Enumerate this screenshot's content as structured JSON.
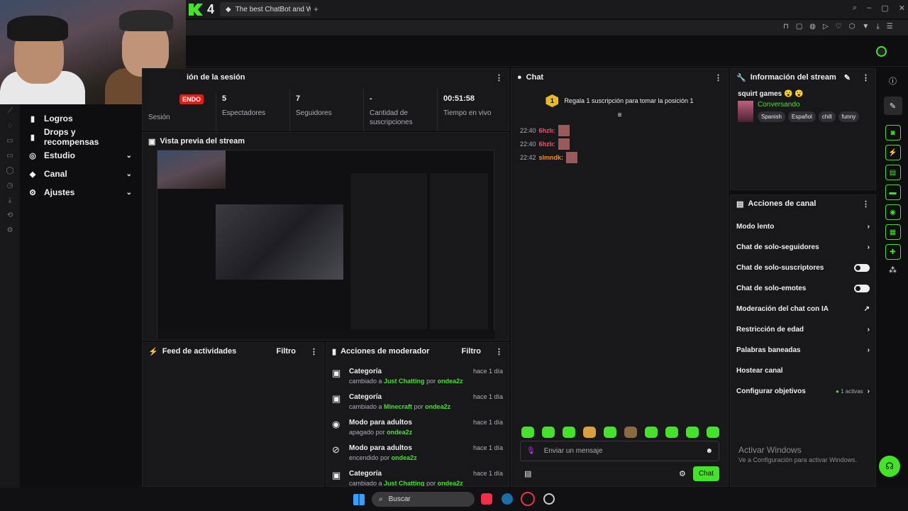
{
  "browser": {
    "tab_title": "The best ChatBot and Wi...",
    "brand": "4"
  },
  "nav": {
    "items": [
      {
        "label": "Logros",
        "icon": "▮"
      },
      {
        "label": "Drops y recompensas",
        "icon": "▮"
      },
      {
        "label": "Estudio",
        "icon": "◎",
        "chev": "⌄"
      },
      {
        "label": "Canal",
        "icon": "◆",
        "chev": "⌄"
      },
      {
        "label": "Ajustes",
        "icon": "⚙",
        "chev": "⌄"
      }
    ]
  },
  "session": {
    "title": "ión de la sesión",
    "live_badge": "ENDO",
    "session_label": "Sesión",
    "stats": [
      {
        "value": "5",
        "label": "Espectadores"
      },
      {
        "value": "7",
        "label": "Seguidores"
      },
      {
        "value": "-",
        "label": "Cantidad de suscripciones"
      },
      {
        "value": "00:51:58",
        "label": "Tiempo en vivo"
      }
    ]
  },
  "preview": {
    "title": "Vista previa del stream"
  },
  "activity": {
    "title": "Feed de actividades",
    "filter": "Filtro"
  },
  "mod": {
    "title": "Acciones de moderador",
    "filter": "Filtro",
    "items": [
      {
        "title": "Categoría",
        "pre": "cambiado a",
        "val": "Just Chatting",
        "mid": "por",
        "user": "ondea2z",
        "time": "hace 1 día",
        "icon": "▣"
      },
      {
        "title": "Categoría",
        "pre": "cambiado a",
        "val": "Minecraft",
        "mid": "por",
        "user": "ondea2z",
        "time": "hace 1 día",
        "icon": "▣"
      },
      {
        "title": "Modo para adultos",
        "pre": "apagado",
        "val": "",
        "mid": "por",
        "user": "ondea2z",
        "time": "hace 1 día",
        "icon": "◉"
      },
      {
        "title": "Modo para adultos",
        "pre": "encendido",
        "val": "",
        "mid": "por",
        "user": "ondea2z",
        "time": "hace 1 día",
        "icon": "⊘"
      },
      {
        "title": "Categoría",
        "pre": "cambiado a",
        "val": "Just Chatting",
        "mid": "por",
        "user": "ondea2z",
        "time": "hace 1 día",
        "icon": "▣"
      }
    ]
  },
  "chat": {
    "title": "Chat",
    "gift_text": "Regala 1 suscripción para tomar la posición 1",
    "gift_rank": "1",
    "messages": [
      {
        "time": "22:40",
        "user": "6hzlı:",
        "color": "#ff4f6a"
      },
      {
        "time": "22:40",
        "user": "6hzlı:",
        "color": "#ff4f6a"
      },
      {
        "time": "22:42",
        "user": "slmndk:",
        "color": "#ff8c1a"
      }
    ],
    "placeholder": "Enviar un mensaje",
    "send": "Chat"
  },
  "info": {
    "title": "Información del stream",
    "stream_title": "squirt games 😮 😮",
    "category": "Conversando",
    "tags": [
      "Spanish",
      "Español",
      "chill",
      "funny"
    ]
  },
  "actions": {
    "title": "Acciones de canal",
    "items": [
      {
        "label": "Modo lento",
        "right": "›"
      },
      {
        "label": "Chat de solo-seguidores",
        "right": "›"
      },
      {
        "label": "Chat de solo-suscriptores",
        "right": "toggle"
      },
      {
        "label": "Chat de solo-emotes",
        "right": "toggle"
      },
      {
        "label": "Moderación del chat con IA",
        "right": "↗"
      },
      {
        "label": "Restricción de edad",
        "right": "›"
      },
      {
        "label": "Palabras baneadas",
        "right": "›"
      },
      {
        "label": "Hostear canal",
        "right": ""
      },
      {
        "label": "Configurar objetivos",
        "right": "›",
        "extra": "1 activas"
      }
    ]
  },
  "windows": {
    "activate_title": "Activar Windows",
    "activate_sub": "Ve a Configuración para activar Windows.",
    "search": "Buscar"
  },
  "colors": {
    "accent": "#45e22b",
    "live": "#e91916"
  }
}
